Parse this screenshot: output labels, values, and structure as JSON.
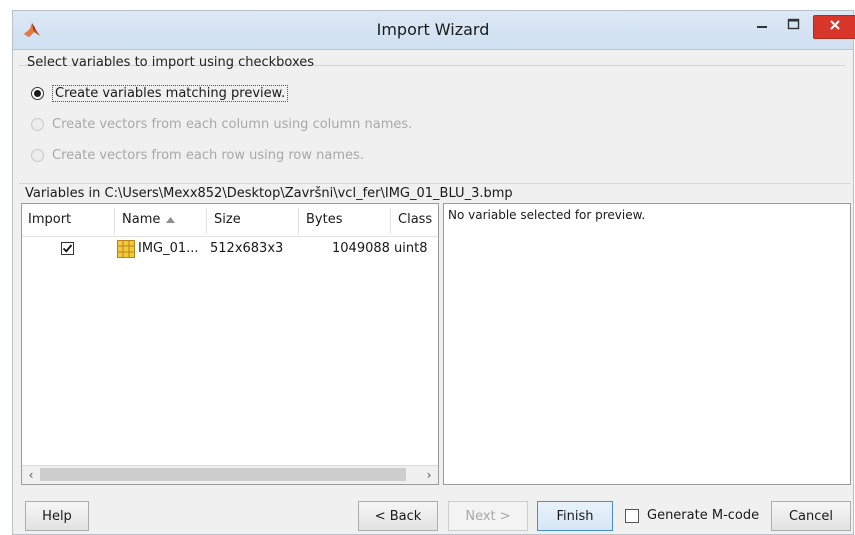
{
  "window": {
    "title": "Import Wizard"
  },
  "options": {
    "group_label": "Select variables to import using checkboxes",
    "radio_matching": "Create variables matching preview.",
    "radio_columns": "Create vectors from each column using column names.",
    "radio_rows": "Create vectors from each row using row names."
  },
  "path": {
    "text": "Variables in C:\\Users\\Mexx852\\Desktop\\Završni\\vcl_fer\\IMG_01_BLU_3.bmp"
  },
  "table": {
    "headers": {
      "import": "Import",
      "name": "Name",
      "size": "Size",
      "bytes": "Bytes",
      "class": "Class"
    },
    "rows": [
      {
        "import": true,
        "name": "IMG_01...",
        "size": "512x683x3",
        "bytes": "1049088",
        "class": "uint8"
      }
    ]
  },
  "preview": {
    "text": "No variable selected for preview."
  },
  "buttons": {
    "help": "Help",
    "back": "< Back",
    "next": "Next >",
    "finish": "Finish",
    "generate": "Generate M-code",
    "cancel": "Cancel"
  },
  "colors": {
    "close_button": "#d9362b",
    "titlebar": "#d6e4f3",
    "default_button_border": "#4a8fd3"
  },
  "icons": {
    "app": "matlab-logo-icon",
    "minimize": "minimize-icon",
    "maximize": "maximize-icon",
    "close": "close-icon",
    "sort": "sort-ascending-icon",
    "variable": "matrix-variable-icon"
  }
}
